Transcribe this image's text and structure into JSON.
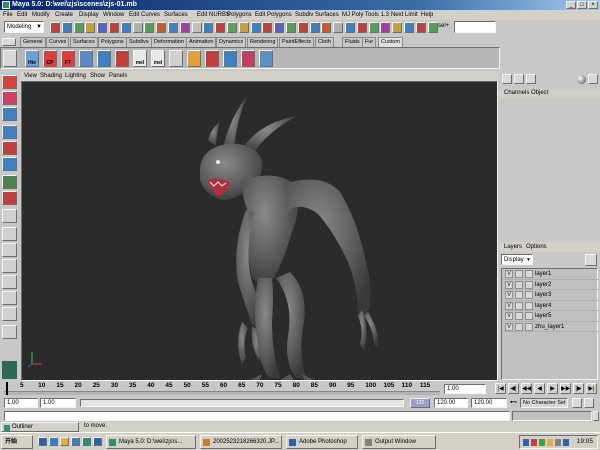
{
  "window": {
    "title": "Maya 5.0: D:\\wei\\zjs\\scenes\\zjs-01.mb"
  },
  "menubar": [
    "File",
    "Edit",
    "Modify",
    "Create",
    "Display",
    "Window",
    "Edit Curves",
    "Surfaces",
    "Edit NURBS",
    "Polygons",
    "Edit Polygons",
    "Subdiv Surfaces",
    "MJ Poly Tools 1.3",
    "Next Limit",
    "Help"
  ],
  "statusline": {
    "mode": "Modeling",
    "sel_label": "sel+"
  },
  "shelf": {
    "tabs": [
      "General",
      "Curves",
      "Surfaces",
      "Polygons",
      "Subdivs",
      "Deformation",
      "Animation",
      "Dynamics",
      "Rendering",
      "PaintEffects",
      "Cloth",
      "Fluids",
      "Fur",
      "Custom"
    ],
    "active_tab": "Custom",
    "icons": [
      {
        "label": "Hie",
        "color": "#6aa0d8"
      },
      {
        "label": "CP",
        "color": "#d84040"
      },
      {
        "label": "FT",
        "color": "#d84040"
      },
      {
        "label": "",
        "color": "#6088c8"
      },
      {
        "label": "",
        "color": "#4080c0"
      },
      {
        "label": "",
        "color": "#c04040"
      },
      {
        "label": "mel",
        "color": "#e8e8e8"
      },
      {
        "label": "mel",
        "color": "#e8e8e8"
      },
      {
        "label": "",
        "color": "#d0d0d0"
      },
      {
        "label": "",
        "color": "#e0a040"
      },
      {
        "label": "",
        "color": "#c04040"
      },
      {
        "label": "",
        "color": "#4080c0"
      },
      {
        "label": "",
        "color": "#c04060"
      },
      {
        "label": "",
        "color": "#6090c0"
      }
    ]
  },
  "panel_menu": [
    "View",
    "Shading",
    "Lighting",
    "Show",
    "Panels"
  ],
  "channel_box": {
    "tabs": [
      "Channels",
      "Object"
    ]
  },
  "layers": {
    "menu": [
      "Layers",
      "Options"
    ],
    "display_select": "Display",
    "items": [
      {
        "visible": "V",
        "name": "layer1"
      },
      {
        "visible": "V",
        "name": "layer2"
      },
      {
        "visible": "V",
        "name": "layer3"
      },
      {
        "visible": "V",
        "name": "layer4"
      },
      {
        "visible": "V",
        "name": "layer5"
      },
      {
        "visible": "V",
        "name": "zhu_layer1"
      }
    ]
  },
  "time_slider": {
    "ticks": [
      "5",
      "10",
      "15",
      "20",
      "25",
      "30",
      "35",
      "40",
      "45",
      "50",
      "55",
      "60",
      "65",
      "70",
      "75",
      "80",
      "85",
      "90",
      "95",
      "100",
      "105",
      "110",
      "115"
    ],
    "current_time": "1.00"
  },
  "range_slider": {
    "start_time": "1.00",
    "playback_start": "1.00",
    "handle_label": "120",
    "playback_end": "120.00",
    "end_time": "120.00",
    "character_set": "No Character Set"
  },
  "help_line": "to move.",
  "taskbar": {
    "start": "开始",
    "outliner": "Outliner",
    "tasks": [
      {
        "label": "Maya 5.0: D:\\wei\\zjs\\s...",
        "color": "#2d8f6f"
      },
      {
        "label": "2002523218266320.JP...",
        "color": "#c08030"
      },
      {
        "label": "Adobe Photoshop",
        "color": "#3060b0"
      },
      {
        "label": "Output Window",
        "color": "#808080"
      }
    ],
    "clock": "19:05"
  }
}
